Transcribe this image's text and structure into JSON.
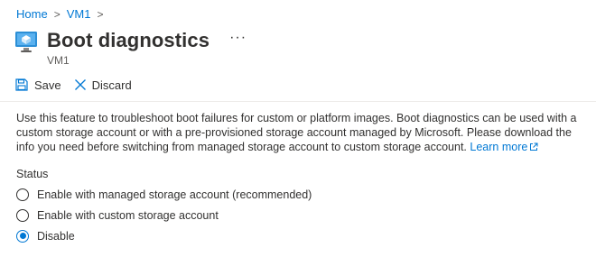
{
  "breadcrumb": {
    "items": [
      "Home",
      "VM1"
    ]
  },
  "header": {
    "title": "Boot diagnostics",
    "subtitle": "VM1",
    "more_label": "···"
  },
  "toolbar": {
    "save_label": "Save",
    "discard_label": "Discard"
  },
  "description": {
    "text": "Use this feature to troubleshoot boot failures for custom or platform images. Boot diagnostics can be used with a custom storage account or with a pre-provisioned storage account managed by Microsoft. Please download the info you need before switching from managed storage account to custom storage account.",
    "link_label": "Learn more"
  },
  "status": {
    "label": "Status",
    "options": [
      {
        "label": "Enable with managed storage account (recommended)",
        "selected": false
      },
      {
        "label": "Enable with custom storage account",
        "selected": false
      },
      {
        "label": "Disable",
        "selected": true
      }
    ]
  },
  "colors": {
    "accent": "#0078d4",
    "text": "#323130",
    "muted": "#605e5c"
  }
}
